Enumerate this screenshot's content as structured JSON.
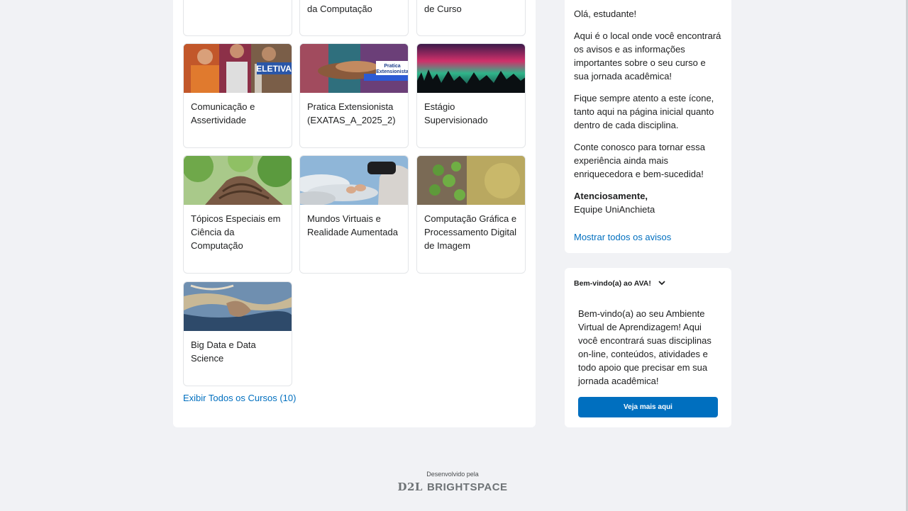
{
  "courses": {
    "partial_titles": [
      "da Computação",
      "de Curso"
    ],
    "items": [
      {
        "title": "Comunicação e Assertividade",
        "image": "people-eletiva",
        "badge": "ELETIVA"
      },
      {
        "title": "Pratica Extensionista (EXATAS_A_2025_2)",
        "image": "hands-together",
        "badge": "Pratica Extensionista"
      },
      {
        "title": "Estágio Supervisionado",
        "image": "aurora-forest",
        "badge": ""
      },
      {
        "title": "Tópicos Especiais em Ciência da Computação",
        "image": "tree-trunk-sky",
        "badge": ""
      },
      {
        "title": "Mundos Virtuais e Realidade Aumentada",
        "image": "vr-headset-person",
        "badge": ""
      },
      {
        "title": "Computação Gráfica e Processamento Digital de Imagem",
        "image": "ivy-tree-bark",
        "badge": ""
      },
      {
        "title": "Big Data e Data Science",
        "image": "wood-texture",
        "badge": ""
      }
    ],
    "view_all_label": "Exibir Todos os Cursos (10)"
  },
  "news": {
    "greeting": "Olá, estudante!",
    "paragraph1": "Aqui é o local onde você encontrará os avisos e as informações importantes sobre o seu curso e sua jornada acadêmica!",
    "paragraph2": "Fique sempre atento a este ícone, tanto aqui na página inicial quanto dentro de cada disciplina.",
    "paragraph3": "Conte conosco para tornar essa experiência ainda mais enriquecedora e bem-sucedida!",
    "signoff": "Atenciosamente,",
    "signature": "Equipe UniAnchieta",
    "show_all_label": "Mostrar todos os avisos"
  },
  "welcome": {
    "title": "Bem-vindo(a) ao AVA!",
    "icon": "chevron-down-icon",
    "body": "Bem-vindo(a) ao seu Ambiente Virtual de Aprendizagem! Aqui você encontrará suas disciplinas on-line, conteúdos, atividades e todo apoio que precisar em sua jornada acadêmica!",
    "button_label": "Veja mais aqui"
  },
  "footer": {
    "developed_by": "Desenvolvido pela",
    "logo_d2l": "D2L",
    "logo_brightspace": "BRIGHTSPACE"
  },
  "colors": {
    "link": "#006fbf",
    "button": "#006fbf",
    "background": "#f1f2f5"
  }
}
